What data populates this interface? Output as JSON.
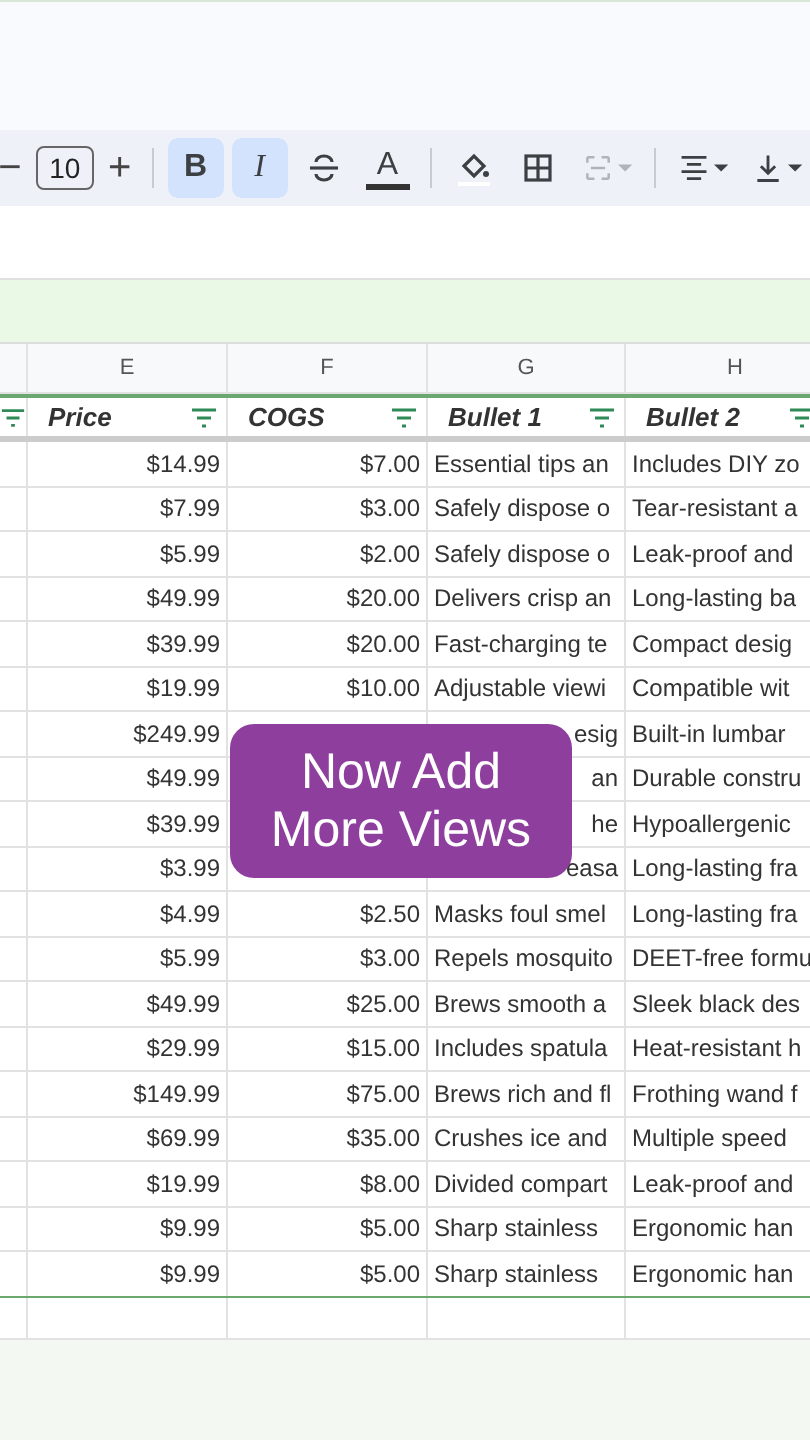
{
  "toolbar": [
    {
      "kind": "step",
      "label": "−"
    },
    {
      "kind": "size",
      "value": "10"
    },
    {
      "kind": "step",
      "label": "+"
    },
    {
      "kind": "sep"
    },
    {
      "kind": "bold",
      "label": "B",
      "selected": true
    },
    {
      "kind": "italic",
      "label": "I",
      "selected": true
    },
    {
      "kind": "strike"
    },
    {
      "kind": "textcolor",
      "label": "A",
      "selected": false
    },
    {
      "kind": "sep"
    },
    {
      "kind": "fill"
    },
    {
      "kind": "borders"
    },
    {
      "kind": "merge",
      "disabled": true
    },
    {
      "kind": "sep"
    },
    {
      "kind": "align"
    },
    {
      "kind": "valign"
    }
  ],
  "columns": [
    {
      "letter": "E",
      "header": "Price"
    },
    {
      "letter": "F",
      "header": "COGS"
    },
    {
      "letter": "G",
      "header": "Bullet 1"
    },
    {
      "letter": "H",
      "header": "Bullet 2"
    }
  ],
  "rows": [
    {
      "price": "$14.99",
      "cogs": "$7.00",
      "bullet_1": "Essential tips an",
      "bullet_2": "Includes DIY zo"
    },
    {
      "price": "$7.99",
      "cogs": "$3.00",
      "bullet_1": "Safely dispose o",
      "bullet_2": "Tear-resistant a"
    },
    {
      "price": "$5.99",
      "cogs": "$2.00",
      "bullet_1": "Safely dispose o",
      "bullet_2": "Leak-proof and"
    },
    {
      "price": "$49.99",
      "cogs": "$20.00",
      "bullet_1": "Delivers crisp an",
      "bullet_2": "Long-lasting ba"
    },
    {
      "price": "$39.99",
      "cogs": "$20.00",
      "bullet_1": "Fast-charging te",
      "bullet_2": "Compact desig"
    },
    {
      "price": "$19.99",
      "cogs": "$10.00",
      "bullet_1": "Adjustable viewi",
      "bullet_2": "Compatible wit"
    },
    {
      "price": "$249.99",
      "bullet_1_end": "esig",
      "bullet_2": "Built-in lumbar"
    },
    {
      "price": "$49.99",
      "bullet_1_end": "an",
      "bullet_2": "Durable constru"
    },
    {
      "price": "$39.99",
      "bullet_1_end": "he",
      "bullet_2": "Hypoallergenic"
    },
    {
      "price": "$3.99",
      "bullet_1_end": "easa",
      "bullet_2": "Long-lasting fra"
    },
    {
      "price": "$4.99",
      "cogs": "$2.50",
      "bullet_1": "Masks foul smel",
      "bullet_2": "Long-lasting fra"
    },
    {
      "price": "$5.99",
      "cogs": "$3.00",
      "bullet_1": "Repels mosquito",
      "bullet_2": "DEET-free formu"
    },
    {
      "price": "$49.99",
      "cogs": "$25.00",
      "bullet_1": "Brews smooth a",
      "bullet_2": "Sleek black des"
    },
    {
      "price": "$29.99",
      "cogs": "$15.00",
      "bullet_1": "Includes spatula",
      "bullet_2": "Heat-resistant h"
    },
    {
      "price": "$149.99",
      "cogs": "$75.00",
      "bullet_1": "Brews rich and fl",
      "bullet_2": "Frothing wand f"
    },
    {
      "price": "$69.99",
      "cogs": "$35.00",
      "bullet_1": "Crushes ice and",
      "bullet_2": "Multiple speed"
    },
    {
      "price": "$19.99",
      "cogs": "$8.00",
      "bullet_1": "Divided compart",
      "bullet_2": "Leak-proof and"
    },
    {
      "price": "$9.99",
      "cogs": "$5.00",
      "bullet_1": "Sharp stainless",
      "bullet_2": "Ergonomic han"
    },
    {
      "price": "$9.99",
      "cogs": "$5.00",
      "bullet_1": "Sharp stainless",
      "bullet_2": "Ergonomic han"
    }
  ],
  "overlay": {
    "lines": [
      "Now Add",
      "More Views"
    ]
  }
}
